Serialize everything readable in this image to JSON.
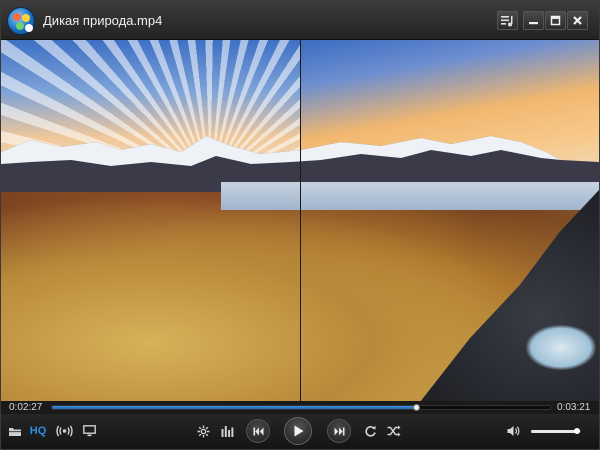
{
  "window": {
    "title": "Дикая природа.mp4"
  },
  "playback": {
    "elapsed": "0:02:27",
    "total": "0:03:21",
    "progress_fraction": 0.731,
    "volume_fraction": 0.92
  },
  "controls": {
    "hq_label": "HQ"
  },
  "colors": {
    "accent": "#2e8fe6",
    "progress_fill": "#3b8fe0",
    "background": "#1c1c1c"
  },
  "icons": {
    "titlebar": [
      "playlist-icon",
      "minimize-icon",
      "maximize-icon",
      "close-icon"
    ],
    "controls_left": [
      "open-folder-icon",
      "hq-icon",
      "broadcast-icon",
      "screen-icon"
    ],
    "controls_center": [
      "settings-icon",
      "equalizer-icon",
      "previous-icon",
      "play-icon",
      "next-icon",
      "repeat-icon",
      "shuffle-icon"
    ],
    "controls_right": [
      "volume-icon"
    ]
  }
}
